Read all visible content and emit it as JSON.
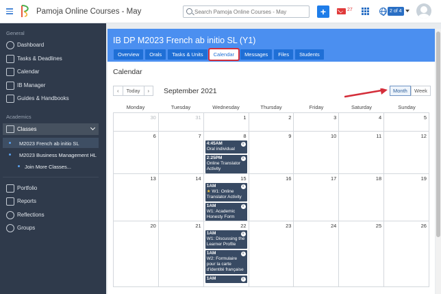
{
  "app": {
    "title": "Pamoja Online Courses - May",
    "search_placeholder": "Search Pamoja Online Courses - May",
    "mail_count": "27",
    "pager": "2 of 4"
  },
  "sidebar": {
    "general_label": "General",
    "general_items": [
      {
        "label": "Dashboard",
        "icon": "dashboard-icon"
      },
      {
        "label": "Tasks & Deadlines",
        "icon": "tasks-icon"
      },
      {
        "label": "Calendar",
        "icon": "calendar-icon"
      },
      {
        "label": "IB Manager",
        "icon": "ib-manager-icon"
      },
      {
        "label": "Guides & Handbooks",
        "icon": "book-icon"
      }
    ],
    "academics_label": "Academics",
    "classes_label": "Classes",
    "classes": [
      {
        "label": "M2023 French ab initio SL",
        "active": true
      },
      {
        "label": "M2023 Business Management HL",
        "active": false
      }
    ],
    "join_label": "Join More Classes...",
    "bottom_items": [
      {
        "label": "Portfolio",
        "icon": "portfolio-icon"
      },
      {
        "label": "Reports",
        "icon": "reports-icon"
      },
      {
        "label": "Reflections",
        "icon": "reflections-icon"
      },
      {
        "label": "Groups",
        "icon": "groups-icon"
      }
    ]
  },
  "course": {
    "title": "IB DP M2023 French ab initio SL (Y1)",
    "tabs": [
      "Overview",
      "Orals",
      "Tasks & Units",
      "Calendar",
      "Messages",
      "Files",
      "Students"
    ],
    "active_tab": "Calendar"
  },
  "calendar": {
    "heading": "Calendar",
    "today_label": "Today",
    "prev_label": "‹",
    "next_label": "›",
    "month_title": "September 2021",
    "view_month": "Month",
    "view_week": "Week",
    "weekdays": [
      "Monday",
      "Tuesday",
      "Wednesday",
      "Thursday",
      "Friday",
      "Saturday",
      "Sunday"
    ],
    "weeks": [
      {
        "days": [
          {
            "n": "30",
            "other": true
          },
          {
            "n": "31",
            "other": true
          },
          {
            "n": "1"
          },
          {
            "n": "2"
          },
          {
            "n": "3"
          },
          {
            "n": "4"
          },
          {
            "n": "5"
          }
        ]
      },
      {
        "days": [
          {
            "n": "6"
          },
          {
            "n": "7"
          },
          {
            "n": "8",
            "events": [
              {
                "time": "4:45AM",
                "desc": "Oral individual"
              },
              {
                "time": "2:25PM",
                "desc": "Online Translator Activity"
              }
            ]
          },
          {
            "n": "9"
          },
          {
            "n": "10"
          },
          {
            "n": "11"
          },
          {
            "n": "12"
          }
        ]
      },
      {
        "days": [
          {
            "n": "13"
          },
          {
            "n": "14"
          },
          {
            "n": "15",
            "events": [
              {
                "time": "1AM",
                "desc": "W1: Online Translator Activity",
                "star": true
              },
              {
                "time": "1AM",
                "desc": "W1: Academic Honesty Form"
              }
            ]
          },
          {
            "n": "16"
          },
          {
            "n": "17"
          },
          {
            "n": "18"
          },
          {
            "n": "19"
          }
        ]
      },
      {
        "days": [
          {
            "n": "20"
          },
          {
            "n": "21"
          },
          {
            "n": "22",
            "events": [
              {
                "time": "1AM",
                "desc": "W1: Discussing the Learner Profile"
              },
              {
                "time": "1AM",
                "desc": "W2: Formulaire pour la carte d'identité française"
              },
              {
                "time": "1AM",
                "desc": ""
              }
            ]
          },
          {
            "n": "23"
          },
          {
            "n": "24"
          },
          {
            "n": "25"
          },
          {
            "n": "26"
          }
        ]
      }
    ]
  },
  "colors": {
    "header_blue": "#4b8ff0",
    "tab_blue": "#1f6fd6",
    "sidebar": "#2f3a4b",
    "event": "#384a63",
    "highlight_red": "#d42e3a"
  }
}
